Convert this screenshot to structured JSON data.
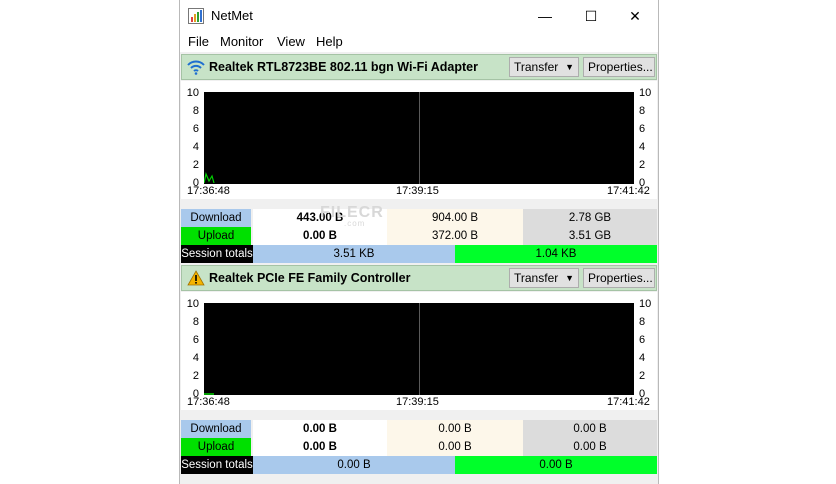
{
  "window": {
    "title": "NetMet",
    "controls": {
      "minimize": "—",
      "maximize": "☐",
      "close": "✕"
    }
  },
  "menu": [
    "File",
    "Monitor",
    "View",
    "Help"
  ],
  "y_ticks": [
    "10",
    "8",
    "6",
    "4",
    "2",
    "0"
  ],
  "watermark": {
    "brand": "FILECR",
    "sub": ".com"
  },
  "adapters": [
    {
      "name": "Realtek RTL8723BE 802.11 bgn Wi-Fi Adapter",
      "icon": "wifi-icon",
      "mode_label": "Transfer",
      "properties_label": "Properties...",
      "times": [
        "17:36:48",
        "17:39:15",
        "17:41:42"
      ],
      "download": {
        "label": "Download",
        "v1": "443.00 B",
        "v2": "904.00 B",
        "v3": "2.78 GB"
      },
      "upload": {
        "label": "Upload",
        "v1": "0.00 B",
        "v2": "372.00 B",
        "v3": "3.51 GB"
      },
      "session": {
        "label": "Session totals",
        "down": "3.51 KB",
        "up": "1.04 KB"
      }
    },
    {
      "name": "Realtek PCIe FE Family Controller",
      "icon": "warning-icon",
      "mode_label": "Transfer",
      "properties_label": "Properties...",
      "times": [
        "17:36:48",
        "17:39:15",
        "17:41:42"
      ],
      "download": {
        "label": "Download",
        "v1": "0.00 B",
        "v2": "0.00 B",
        "v3": "0.00 B"
      },
      "upload": {
        "label": "Upload",
        "v1": "0.00 B",
        "v2": "0.00 B",
        "v3": "0.00 B"
      },
      "session": {
        "label": "Session totals",
        "down": "0.00 B",
        "up": "0.00 B"
      }
    }
  ],
  "colors": {
    "header_bg": "#c7e3c7",
    "plot_bg": "#000000",
    "download": "#a9c9ec",
    "upload": "#00e000",
    "session_up": "#00ff2a"
  }
}
